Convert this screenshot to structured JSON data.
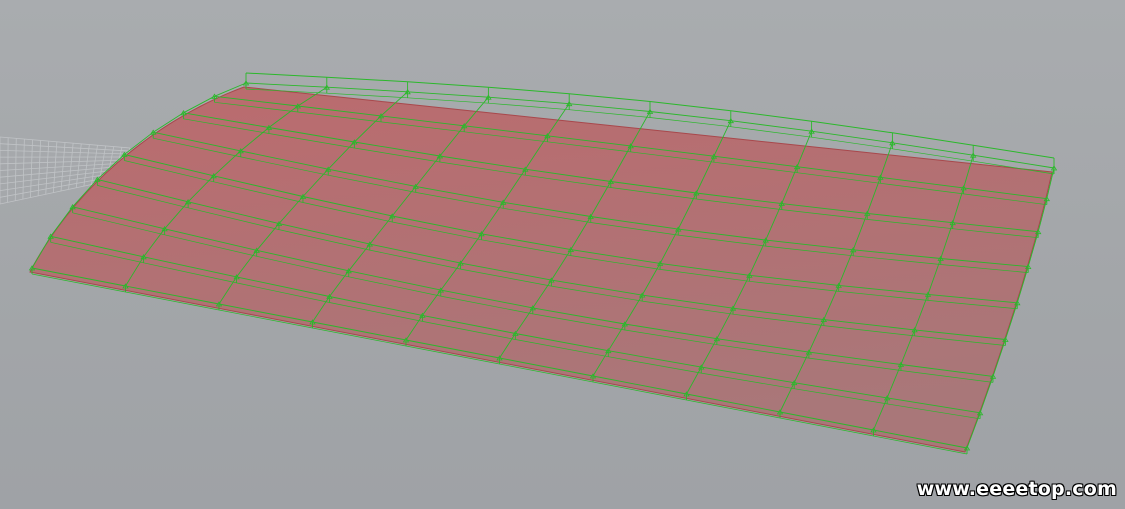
{
  "viewport": {
    "background_color": "#a3a6aa",
    "grid_color": "#c0c3c6",
    "surface_color": "#b8676a",
    "surface_edge_color": "#a8484c",
    "control_cage_color": "#2bb82b"
  },
  "surface": {
    "u_segments": 10,
    "v_segments": 8
  },
  "watermark": {
    "text": "www.eeeetop.com"
  }
}
